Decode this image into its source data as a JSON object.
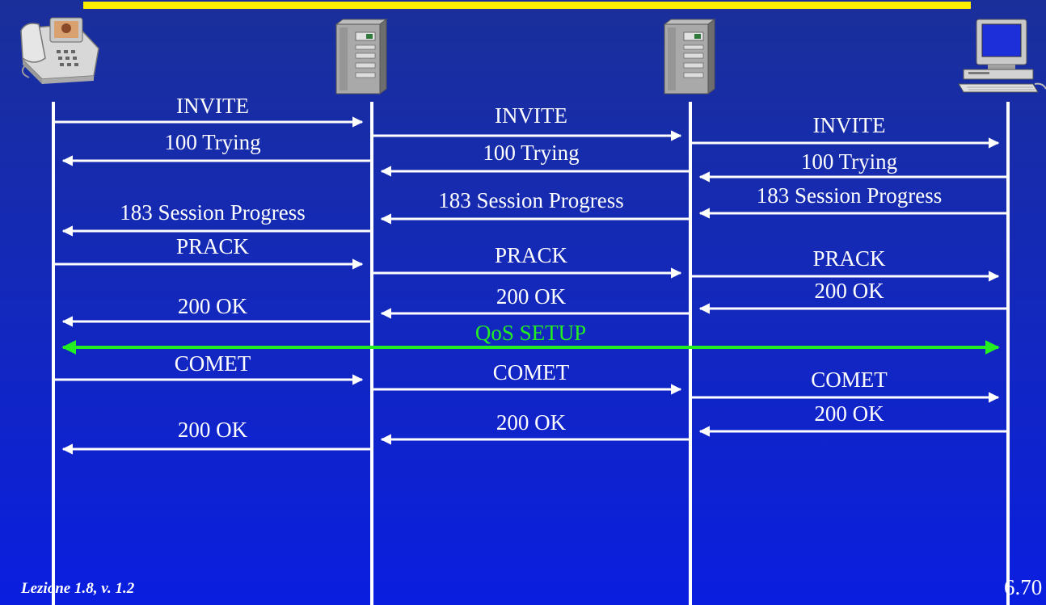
{
  "diagram": {
    "entities": [
      {
        "name": "videophone",
        "icon": "phone-icon"
      },
      {
        "name": "proxy-1",
        "icon": "server-icon"
      },
      {
        "name": "proxy-2",
        "icon": "server-icon"
      },
      {
        "name": "computer",
        "icon": "computer-icon"
      }
    ],
    "messages": [
      {
        "label": "INVITE",
        "from": 0,
        "to": 1,
        "dir": "right"
      },
      {
        "label": "INVITE",
        "from": 1,
        "to": 2,
        "dir": "right"
      },
      {
        "label": "INVITE",
        "from": 2,
        "to": 3,
        "dir": "right"
      },
      {
        "label": "100 Trying",
        "from": 1,
        "to": 0,
        "dir": "left"
      },
      {
        "label": "100 Trying",
        "from": 2,
        "to": 1,
        "dir": "left"
      },
      {
        "label": "100 Trying",
        "from": 3,
        "to": 2,
        "dir": "left"
      },
      {
        "label": "183 Session Progress",
        "from": 1,
        "to": 0,
        "dir": "left"
      },
      {
        "label": "183 Session Progress",
        "from": 2,
        "to": 1,
        "dir": "left"
      },
      {
        "label": "183 Session Progress",
        "from": 3,
        "to": 2,
        "dir": "left"
      },
      {
        "label": "PRACK",
        "from": 0,
        "to": 1,
        "dir": "right"
      },
      {
        "label": "PRACK",
        "from": 1,
        "to": 2,
        "dir": "right"
      },
      {
        "label": "PRACK",
        "from": 2,
        "to": 3,
        "dir": "right"
      },
      {
        "label": "200 OK",
        "from": 1,
        "to": 0,
        "dir": "left"
      },
      {
        "label": "200 OK",
        "from": 2,
        "to": 1,
        "dir": "left"
      },
      {
        "label": "200 OK",
        "from": 3,
        "to": 2,
        "dir": "left"
      },
      {
        "label": "QoS SETUP",
        "from": 0,
        "to": 3,
        "dir": "both",
        "color": "#22ee22"
      },
      {
        "label": "COMET",
        "from": 0,
        "to": 1,
        "dir": "right"
      },
      {
        "label": "COMET",
        "from": 1,
        "to": 2,
        "dir": "right"
      },
      {
        "label": "COMET",
        "from": 2,
        "to": 3,
        "dir": "right"
      },
      {
        "label": "200 OK",
        "from": 1,
        "to": 0,
        "dir": "left"
      },
      {
        "label": "200 OK",
        "from": 2,
        "to": 1,
        "dir": "left"
      },
      {
        "label": "200 OK",
        "from": 3,
        "to": 2,
        "dir": "left"
      }
    ]
  },
  "footer": {
    "left": "Lezione 1.8, v. 1.2",
    "right": "6.70"
  },
  "colors": {
    "background_top": "#1a2f9a",
    "background_bottom": "#0a1ee0",
    "title_bar": "#ffee00",
    "lines": "#ffffff",
    "qos": "#22ee22"
  }
}
